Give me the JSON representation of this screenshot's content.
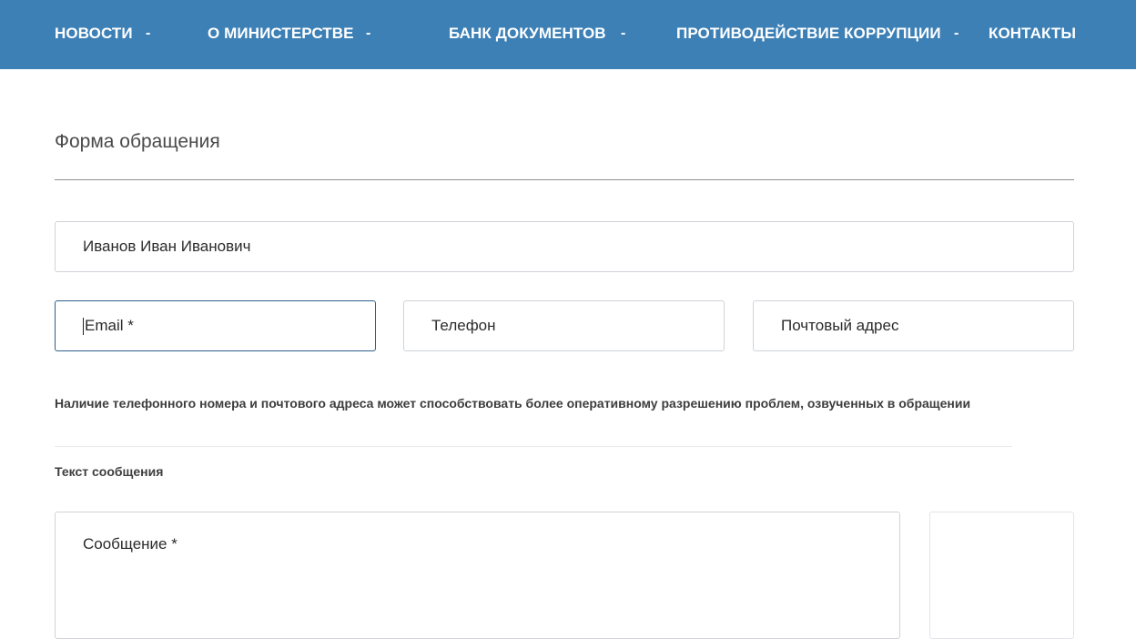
{
  "nav": {
    "items": [
      {
        "label": "НОВОСТИ",
        "chevron": "-"
      },
      {
        "label": "О МИНИСТЕРСТВЕ",
        "chevron": "-"
      },
      {
        "label": "БАНК ДОКУМЕНТОВ",
        "chevron": "-"
      },
      {
        "label": "ПРОТИВОДЕЙСТВИЕ КОРРУПЦИИ",
        "chevron": "-"
      },
      {
        "label": "КОНТАКТЫ"
      }
    ],
    "background_color": "#3d80b6"
  },
  "form": {
    "title": "Форма обращения",
    "fullname": {
      "value": "Иванов Иван Иванович"
    },
    "email": {
      "placeholder": "Email *",
      "focused": true
    },
    "phone": {
      "placeholder": "Телефон"
    },
    "address": {
      "placeholder": "Почтовый адрес"
    },
    "note": "Наличие телефонного номера и почтового адреса может способствовать более оперативному разрешению проблем, озвученных в обращении",
    "message_section_label": "Текст сообщения",
    "message": {
      "placeholder": "Сообщение *"
    }
  }
}
